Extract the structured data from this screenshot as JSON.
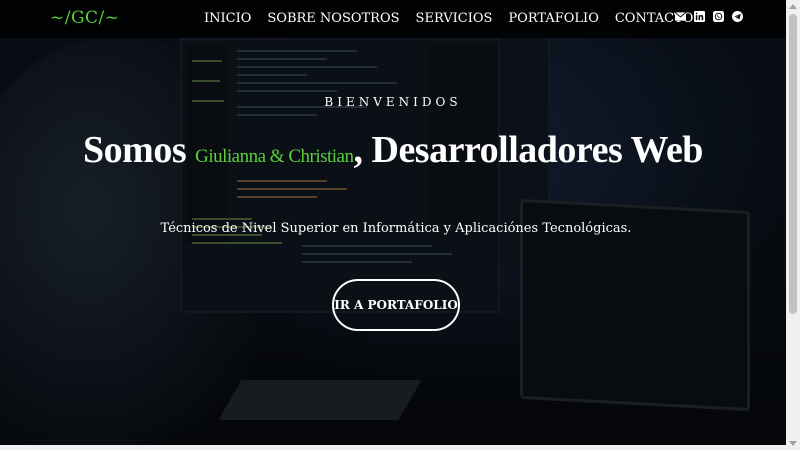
{
  "brand": {
    "logo": "~/GC/~"
  },
  "nav": {
    "links": [
      "INICIO",
      "SOBRE NOSOTROS",
      "SERVICIOS",
      "PORTAFOLIO",
      "CONTACTO"
    ],
    "icons": [
      "envelope-icon",
      "linkedin-icon",
      "whatsapp-icon",
      "telegram-icon"
    ]
  },
  "hero": {
    "welcome": "BIENVENIDOS",
    "headline_prefix": "Somos ",
    "headline_names": "Giulianna & Christian",
    "headline_suffix": ", Desarrolladores Web",
    "subtitle": "Técnicos de Nivel Superior en Informática y Aplicaciónes Tecnológicas.",
    "cta_label": "IR A PORTAFOLIO"
  },
  "colors": {
    "accent": "#58d13a",
    "nav_bg": "#000000",
    "text": "#ffffff"
  }
}
